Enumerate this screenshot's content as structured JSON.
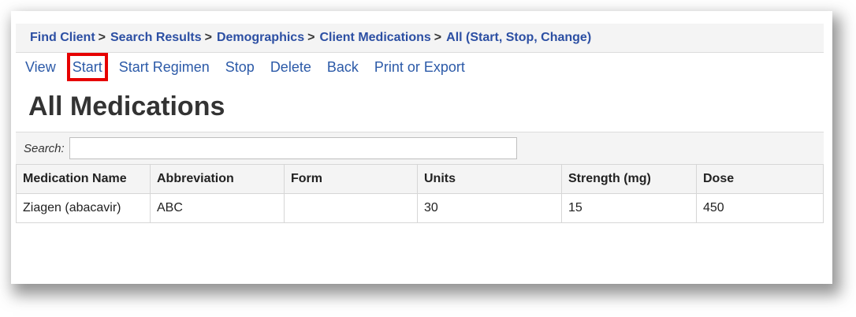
{
  "breadcrumb": [
    {
      "label": "Find Client"
    },
    {
      "label": "Search Results"
    },
    {
      "label": "Demographics"
    },
    {
      "label": "Client Medications"
    },
    {
      "label": "All (Start, Stop, Change)"
    }
  ],
  "breadcrumb_separator": ">",
  "toolbar": {
    "view": "View",
    "start": "Start",
    "start_regimen": "Start Regimen",
    "stop": "Stop",
    "delete": "Delete",
    "back": "Back",
    "print_export": "Print or Export"
  },
  "page_title": "All Medications",
  "search": {
    "label": "Search:",
    "value": ""
  },
  "table": {
    "headers": [
      "Medication Name",
      "Abbreviation",
      "Form",
      "Units",
      "Strength (mg)",
      "Dose"
    ],
    "rows": [
      [
        "Ziagen (abacavir)",
        "ABC",
        "",
        "30",
        "15",
        "450"
      ]
    ]
  },
  "colors": {
    "link": "#2c5aa8",
    "breadcrumb_link": "#2c4fa3",
    "highlight": "#e60000",
    "header_bg": "#f4f4f4"
  }
}
